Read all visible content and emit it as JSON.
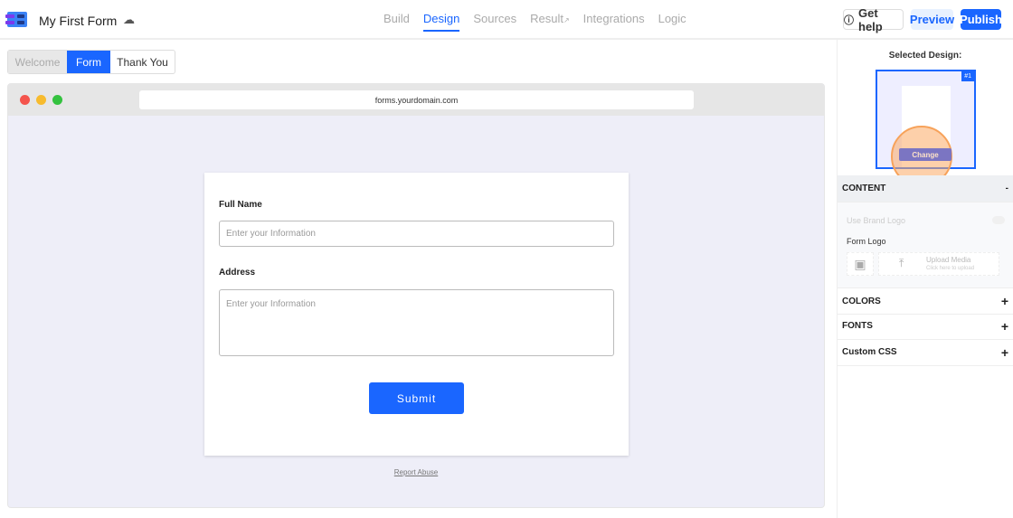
{
  "header": {
    "title": "My First Form",
    "nav": [
      "Build",
      "Design",
      "Sources",
      "Result",
      "Integrations",
      "Logic"
    ],
    "active_nav": "Design",
    "help": "Get help",
    "preview": "Preview",
    "publish": "Publish"
  },
  "tabs": [
    {
      "label": "Welcome"
    },
    {
      "label": "Form"
    },
    {
      "label": "Thank You"
    }
  ],
  "browser": {
    "url": "forms.yourdomain.com"
  },
  "form": {
    "field1_label": "Full Name",
    "field1_placeholder": "Enter your Information",
    "field2_label": "Address",
    "field2_placeholder": "Enter your Information",
    "submit": "Submit",
    "report": "Report Abuse"
  },
  "sidebar": {
    "selected_title": "Selected Design:",
    "design_number": "#1",
    "change": "Change",
    "content": "CONTENT",
    "content_toggle": "-",
    "brand_logo": "Use Brand Logo",
    "form_logo": "Form Logo",
    "upload": "Upload Media",
    "upload_hint": "Click here to upload",
    "colors": "COLORS",
    "fonts": "FONTS",
    "css": "Custom CSS",
    "plus": "+"
  },
  "colors": {
    "accent": "#1a66ff"
  }
}
